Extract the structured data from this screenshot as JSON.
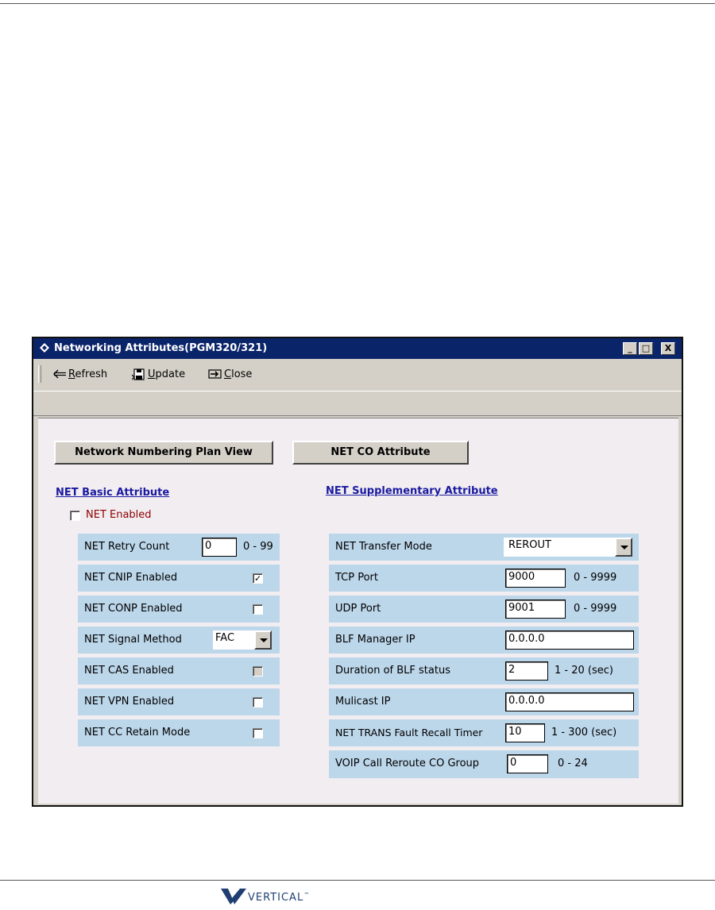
{
  "window": {
    "title": "Networking Attributes(PGM320/321)",
    "controls": [
      "_",
      "□",
      "X"
    ]
  },
  "toolbar": {
    "refresh": "Refresh",
    "update": "Update",
    "close": "Close"
  },
  "buttons": {
    "numbering_plan": "Network Numbering Plan View",
    "co_attribute": "NET CO Attribute"
  },
  "basic": {
    "heading": "NET Basic Attribute",
    "net_enabled_label": "NET Enabled",
    "net_enabled_checked": false,
    "rows": [
      {
        "label": "NET Retry Count",
        "value": "0",
        "range": "0 - 99"
      },
      {
        "label": "NET CNIP Enabled",
        "checked": true
      },
      {
        "label": "NET CONP Enabled",
        "checked": false
      },
      {
        "label": "NET Signal Method",
        "value": "FAC"
      },
      {
        "label": "NET CAS Enabled",
        "checked": false,
        "disabled": true
      },
      {
        "label": "NET VPN Enabled",
        "checked": false
      },
      {
        "label": "NET CC Retain Mode",
        "checked": false
      }
    ]
  },
  "supplementary": {
    "heading": "NET Supplementary Attribute",
    "rows": [
      {
        "label": "NET Transfer Mode",
        "value": "REROUT"
      },
      {
        "label": "TCP Port",
        "value": "9000",
        "range": "0 - 9999"
      },
      {
        "label": "UDP Port",
        "value": "9001",
        "range": "0 - 9999"
      },
      {
        "label": "BLF Manager IP",
        "value": "0.0.0.0"
      },
      {
        "label": "Duration of BLF status",
        "value": "2",
        "range": "1 - 20 (sec)"
      },
      {
        "label": "Mulicast IP",
        "value": "0.0.0.0"
      },
      {
        "label": "NET TRANS Fault Recall Timer",
        "value": "10",
        "range": "1 - 300 (sec)"
      },
      {
        "label": "VOIP Call Reroute CO Group",
        "value": "0",
        "range": "0 - 24"
      }
    ]
  },
  "footer": {
    "logo_text": "VERTICAL",
    "logo_mark": "™"
  },
  "colors": {
    "titlebar": "#0a246a",
    "panel": "#bcd6ea",
    "content_bg": "#f2edf1",
    "link": "#1a1aa0",
    "net_enabled_text": "#8b0000"
  },
  "icons": [
    "app-diamond-icon",
    "refresh-arrow-icon",
    "update-save-icon",
    "close-exit-icon",
    "checkmark-icon",
    "dropdown-arrow-icon",
    "vertical-logo-icon"
  ]
}
